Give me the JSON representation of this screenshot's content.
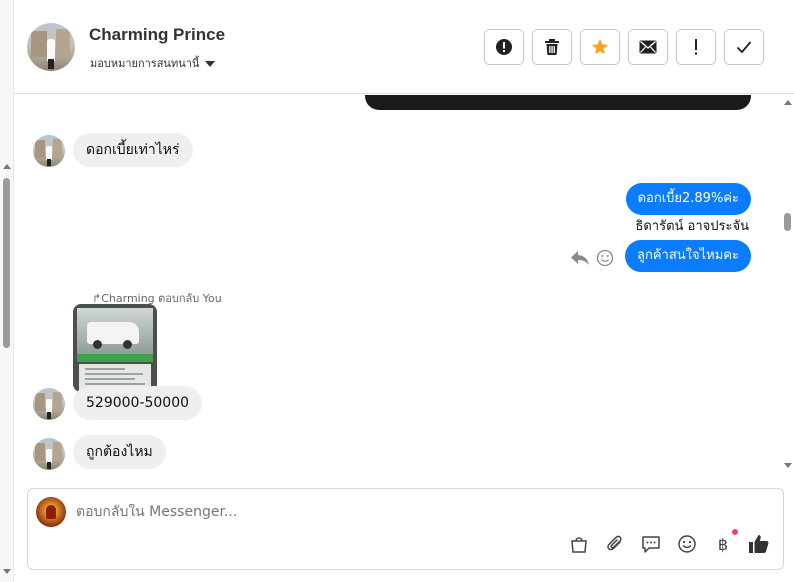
{
  "header": {
    "contact_name": "Charming Prince",
    "assign_label": "มอบหมายการสนทนานี้"
  },
  "toolbar": {
    "buttons": [
      {
        "name": "report",
        "label": "Report spam",
        "icon": "alert-circle-icon"
      },
      {
        "name": "delete",
        "label": "Delete",
        "icon": "trash-icon"
      },
      {
        "name": "star",
        "label": "Star",
        "icon": "star-icon",
        "color": "#f5a623"
      },
      {
        "name": "mail",
        "label": "Mark unread",
        "icon": "envelope-icon"
      },
      {
        "name": "important",
        "label": "Important",
        "icon": "exclamation-icon"
      },
      {
        "name": "done",
        "label": "Done",
        "icon": "check-icon"
      }
    ]
  },
  "messages": {
    "in_1": "ดอกเบี้ยเท่าไหร่",
    "out_1": "ดอกเบี้ย2.89%ค่ะ",
    "out_sender": "ธิดารัตน์ อาจประจัน",
    "out_2": "ลูกค้าสนใจไหมคะ",
    "reply_tag": "Charming ตอบกลับ You",
    "in_2": "529000-50000",
    "in_3": "ถูกต้องไหม"
  },
  "composer": {
    "placeholder": "ตอบกลับใน Messenger..."
  },
  "colors": {
    "outgoing_bubble": "#0a7cff",
    "incoming_bubble": "#efefef",
    "accent_star": "#f5a623",
    "notification_dot": "#f0445e"
  }
}
